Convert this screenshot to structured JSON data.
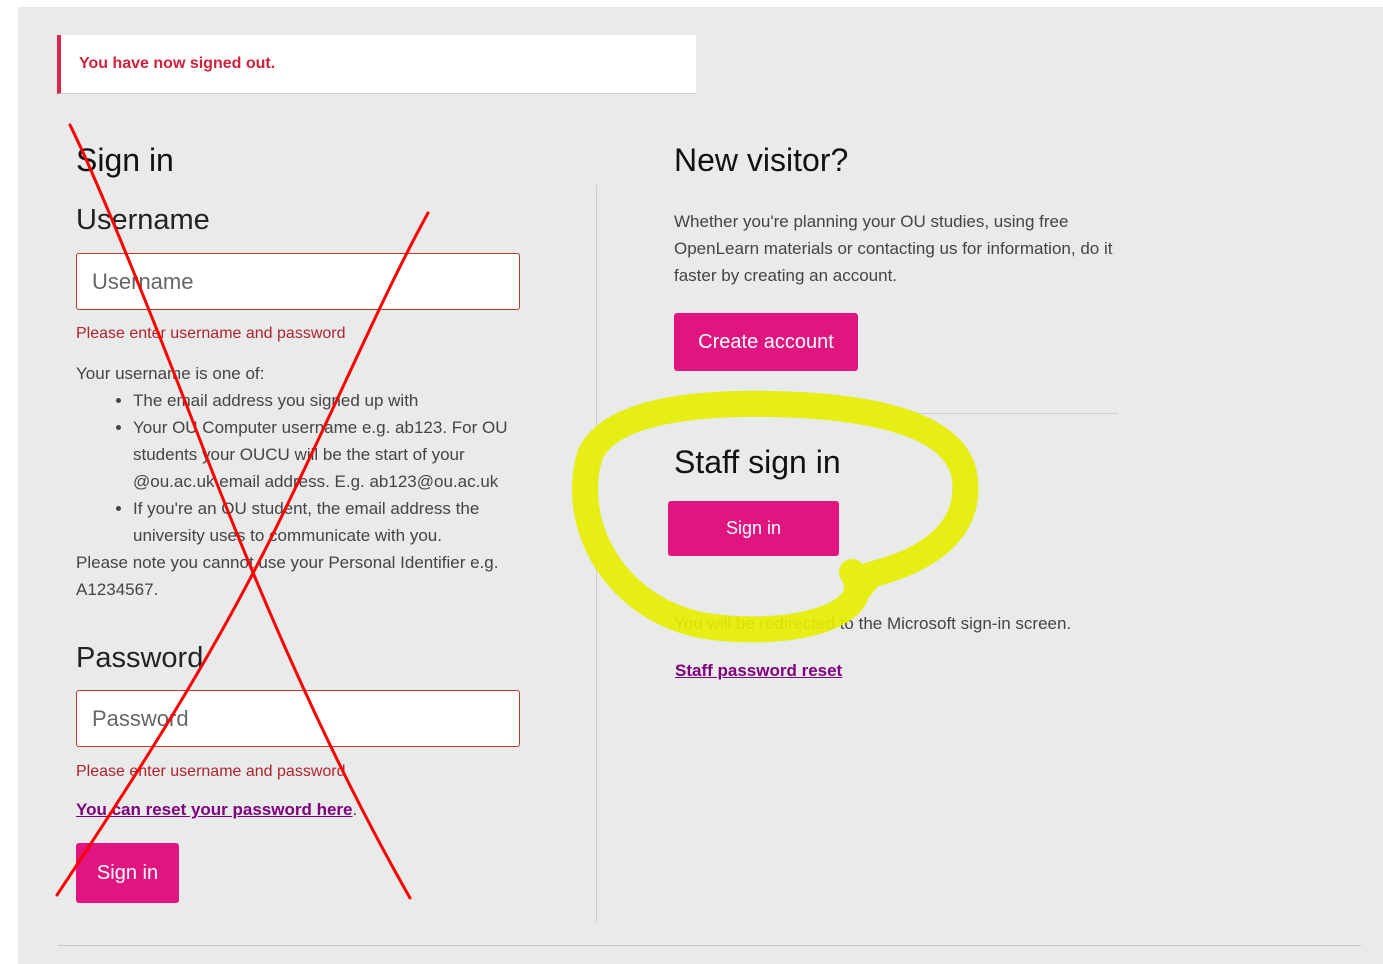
{
  "alert": {
    "message": "You have now signed out."
  },
  "signin": {
    "heading": "Sign in",
    "username_label": "Username",
    "username_placeholder": "Username",
    "username_value": "",
    "username_error": "Please enter username and password",
    "username_help_intro": "Your username is one of:",
    "username_help_items": [
      "The email address you signed up with",
      "Your OU Computer username e.g. ab123. For OU students your OUCU will be the start of your @ou.ac.uk email address. E.g. ab123@ou.ac.uk",
      "If you're an OU student, the email address the university uses to communicate with you."
    ],
    "username_help_note": "Please note you cannot use your Personal Identifier e.g. A1234567.",
    "password_label": "Password",
    "password_placeholder": "Password",
    "password_value": "",
    "password_error": "Please enter username and password",
    "reset_link": "You can reset your password here",
    "reset_link_suffix": ".",
    "submit_label": "Sign in"
  },
  "visitor": {
    "heading": "New visitor?",
    "description": "Whether you're planning your OU studies, using free OpenLearn materials or contacting us for information, do it faster by creating an account.",
    "create_label": "Create account"
  },
  "staff": {
    "heading": "Staff sign in",
    "signin_label": "Sign in",
    "redirect_note": "You will be redirected to the Microsoft sign-in screen.",
    "reset_link": "Staff password reset"
  },
  "colors": {
    "accent": "#e0157f",
    "error": "#b0232e",
    "link": "#800080",
    "annotation_cross": "#ff0000",
    "annotation_highlight": "#e5ee00"
  }
}
